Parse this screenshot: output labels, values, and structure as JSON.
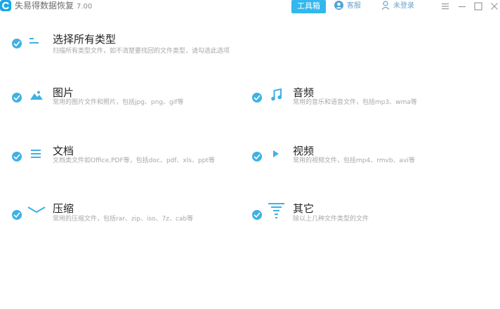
{
  "titlebar": {
    "app_name": "失易得数据恢复",
    "version": "7.00",
    "toolbox_label": "工具箱",
    "support_label": "客服",
    "login_label": "未登录"
  },
  "colors": {
    "accent": "#33b7ec",
    "check": "#3fb1e3",
    "icon": "#3fb1e3"
  },
  "select_all": {
    "title": "选择所有类型",
    "desc": "扫描所有类型文件，如不清楚要找回的文件类型，请勾选此选项"
  },
  "categories": [
    {
      "key": "pictures",
      "title": "图片",
      "desc": "常用的图片文件和照片，包括jpg、png、gif等",
      "icon": "picture-icon"
    },
    {
      "key": "audio",
      "title": "音频",
      "desc": "常用的音乐和语音文件，包括mp3、wma等",
      "icon": "music-note-icon"
    },
    {
      "key": "documents",
      "title": "文档",
      "desc": "文档类文件如Office,PDF等，包括doc、pdf、xls、ppt等",
      "icon": "document-lines-icon"
    },
    {
      "key": "video",
      "title": "视频",
      "desc": "常用的视频文件，包括mp4、rmvb、avi等",
      "icon": "play-icon"
    },
    {
      "key": "archives",
      "title": "压缩",
      "desc": "常用的压缩文件，包括rar、zip、iso、7z、cab等",
      "icon": "archive-icon"
    },
    {
      "key": "other",
      "title": "其它",
      "desc": "除以上几种文件类型的文件",
      "icon": "filter-icon"
    }
  ]
}
